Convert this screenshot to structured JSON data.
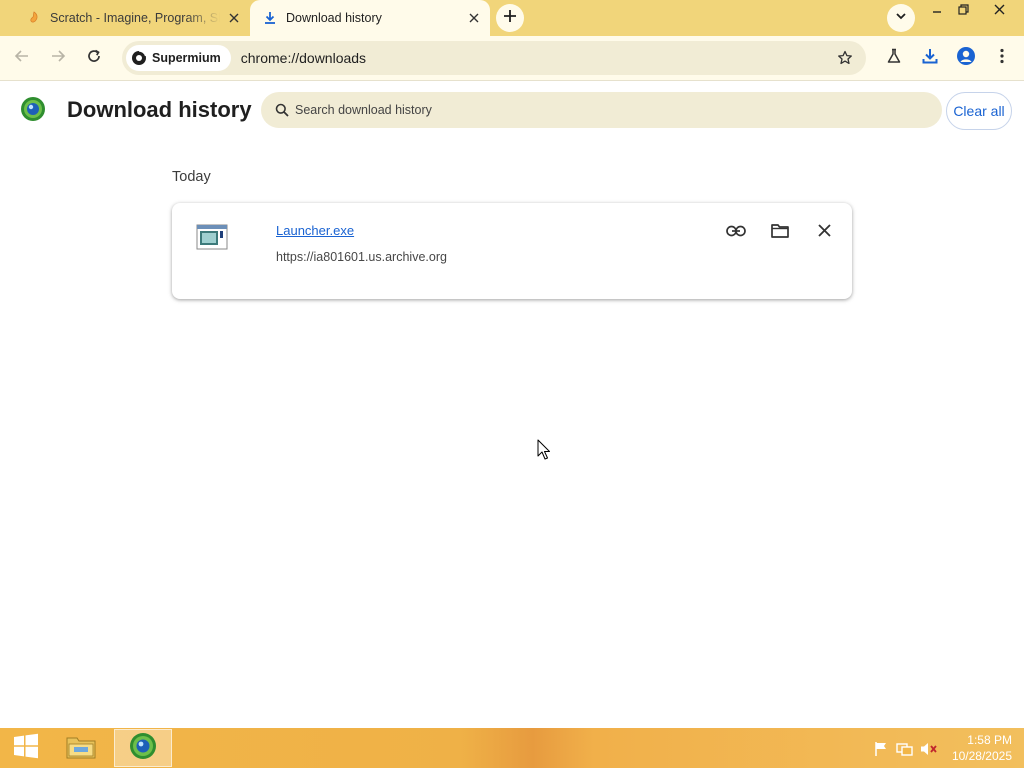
{
  "browser": {
    "tabs": [
      {
        "title": "Scratch - Imagine, Program, Share",
        "active": false,
        "favicon": "scratch-icon"
      },
      {
        "title": "Download history",
        "active": true,
        "favicon": "download-icon"
      }
    ],
    "new_tab_icon": "plus-icon",
    "tab_search_icon": "chevron-down-icon",
    "window_controls": [
      "minimize-icon",
      "restore-icon",
      "close-icon"
    ],
    "toolbar": {
      "back_icon": "arrow-left-icon",
      "forward_icon": "arrow-right-icon",
      "reload_icon": "reload-icon",
      "omnibox_chip": "Supermium",
      "url": "chrome://downloads",
      "right_icons": [
        "star-icon",
        "labs-flask-icon",
        "download-icon",
        "profile-icon",
        "menu-icon"
      ]
    }
  },
  "page": {
    "title": "Download history",
    "search": {
      "placeholder": "Search download history",
      "value": ""
    },
    "clear_all_label": "Clear all",
    "sections": [
      {
        "heading": "Today",
        "items": [
          {
            "file_name": "Launcher.exe",
            "source": "https://ia801601.us.archive.org",
            "actions": [
              "link-icon",
              "folder-icon",
              "close-icon"
            ]
          }
        ]
      }
    ]
  },
  "taskbar": {
    "pinned": [
      "file-explorer-icon",
      "supermium-icon"
    ],
    "tray_icons": [
      "flag-icon",
      "network-icon",
      "volume-muted-icon"
    ],
    "clock": {
      "time": "1:58 PM",
      "date": "10/28/2025"
    }
  },
  "colors": {
    "titlebar": "#f1d57a",
    "toolbar": "#fffbea",
    "accent_link": "#1a63d2",
    "taskbar": "#f2b648"
  }
}
